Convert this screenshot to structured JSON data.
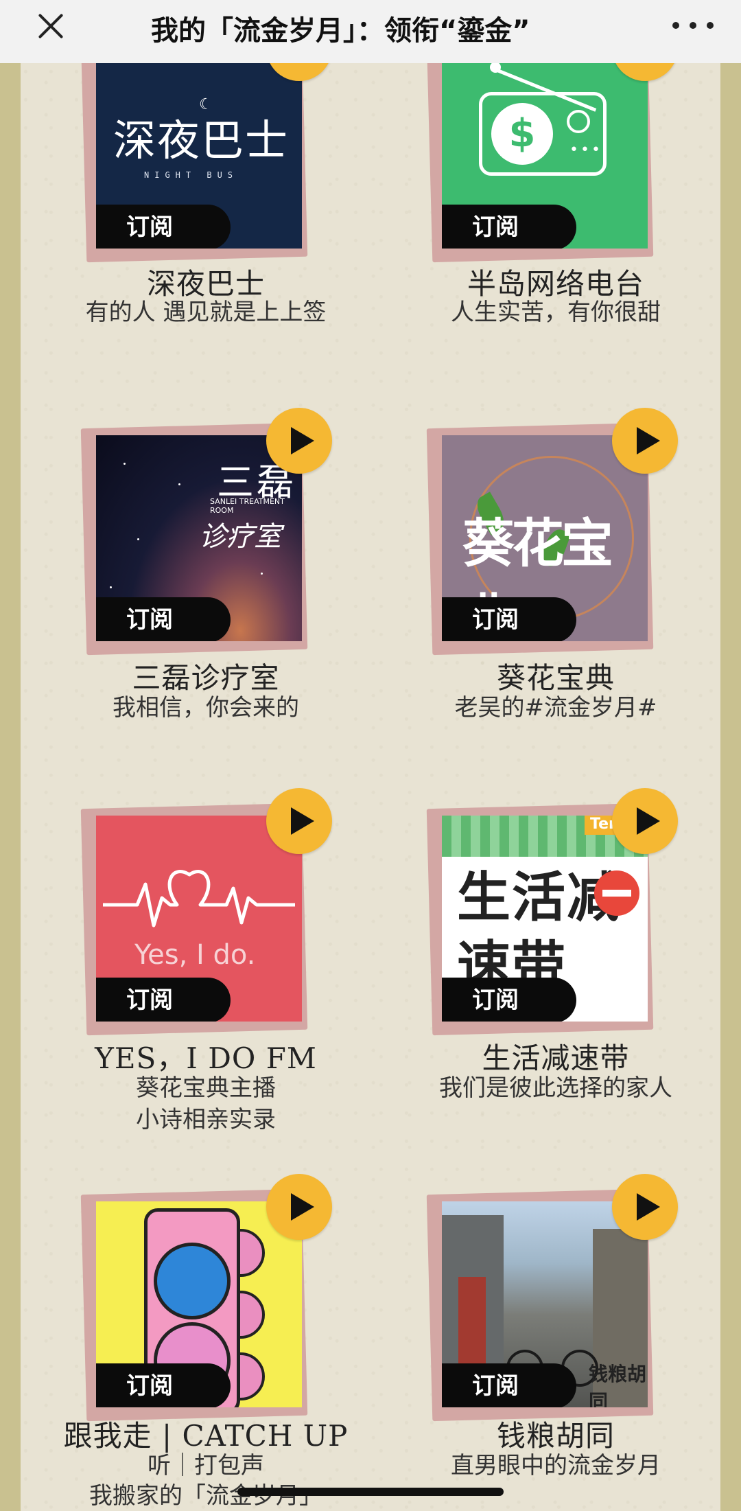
{
  "header": {
    "title": "我的「流金岁月」：领衔“鎏金”"
  },
  "common": {
    "subscribe_label": "订阅"
  },
  "podcasts": [
    {
      "title": "深夜巴士",
      "desc": [
        "有的人 遇见就是上上签"
      ],
      "cover_text": "深夜巴士",
      "cover_subtext": "NIGHT BUS"
    },
    {
      "title": "半岛网络电台",
      "desc": [
        "人生实苦，有你很甜"
      ],
      "cover_text": "$"
    },
    {
      "title": "三磊诊疗室",
      "desc": [
        "我相信，你会来的"
      ],
      "cover_text": "三磊",
      "cover_subtext": "SANLEI TREATMENT ROOM",
      "cover_text2": "诊疗室"
    },
    {
      "title": "葵花宝典",
      "desc": [
        "老吴的#流金岁月#"
      ],
      "cover_text": "葵花宝典"
    },
    {
      "title": "YES，I DO FM",
      "desc": [
        "葵花宝典主播",
        "小诗相亲实录"
      ],
      "cover_text": "Yes, I do."
    },
    {
      "title": "生活减速带",
      "desc": [
        "我们是彼此选择的家人"
      ],
      "cover_text": "生活减速带",
      "cover_tag": "TenS"
    },
    {
      "title": "跟我走 | CATCH UP",
      "desc": [
        "听｜打包声",
        "我搬家的「流金岁月」"
      ]
    },
    {
      "title": "钱粮胡同",
      "desc": [
        "直男眼中的流金岁月"
      ],
      "cover_text": "钱粮胡同"
    }
  ],
  "colors": {
    "play_button": "#f5b833",
    "subscribe_tag": "#0b0b0b",
    "paper": "#e8e3d3",
    "frame": "#cfc79a",
    "cover_shadow": "#d3a7a4"
  },
  "icons": {
    "close": "close-icon",
    "more": "more-dots-icon",
    "play": "play-icon"
  }
}
